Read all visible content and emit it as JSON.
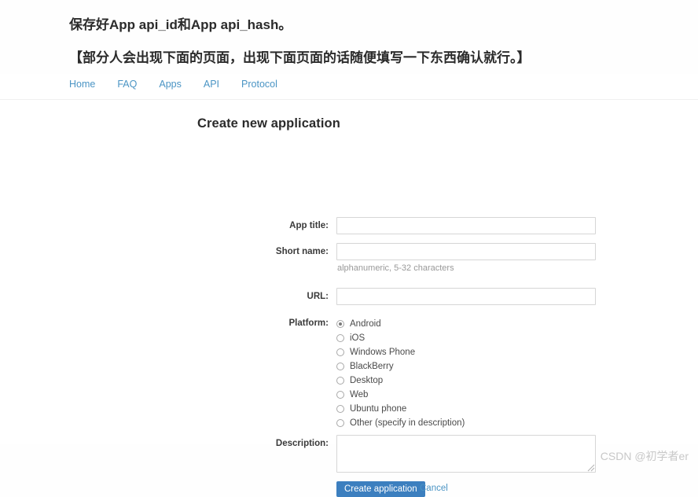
{
  "annotations": {
    "line1": "保存好App api_id和App api_hash。",
    "line2": "【部分人会出现下面的页面，出现下面页面的话随便填写一下东西确认就行。】"
  },
  "nav": {
    "items": [
      {
        "label": "Home"
      },
      {
        "label": "FAQ"
      },
      {
        "label": "Apps"
      },
      {
        "label": "API"
      },
      {
        "label": "Protocol"
      }
    ]
  },
  "form": {
    "title": "Create new application",
    "fields": {
      "app_title": {
        "label": "App title:",
        "value": "",
        "placeholder": ""
      },
      "short_name": {
        "label": "Short name:",
        "value": "",
        "placeholder": "",
        "hint": "alphanumeric, 5-32 characters"
      },
      "url": {
        "label": "URL:",
        "value": "",
        "placeholder": ""
      },
      "platform": {
        "label": "Platform:",
        "selected": "Android",
        "options": [
          {
            "label": "Android",
            "checked": true
          },
          {
            "label": "iOS",
            "checked": false
          },
          {
            "label": "Windows Phone",
            "checked": false
          },
          {
            "label": "BlackBerry",
            "checked": false
          },
          {
            "label": "Desktop",
            "checked": false
          },
          {
            "label": "Web",
            "checked": false
          },
          {
            "label": "Ubuntu phone",
            "checked": false
          },
          {
            "label": "Other (specify in description)",
            "checked": false
          }
        ]
      },
      "description": {
        "label": "Description:",
        "value": "",
        "placeholder": ""
      }
    },
    "actions": {
      "submit_label": "Create application",
      "cancel_label": "Cancel"
    }
  },
  "watermark": {
    "text": "CSDN @初学者er"
  },
  "colors": {
    "link": "#4a94c4",
    "button": "#3c7fbf",
    "text": "#333333",
    "hint": "#999999",
    "border": "#d6d6d6",
    "background": "#fefefe"
  }
}
